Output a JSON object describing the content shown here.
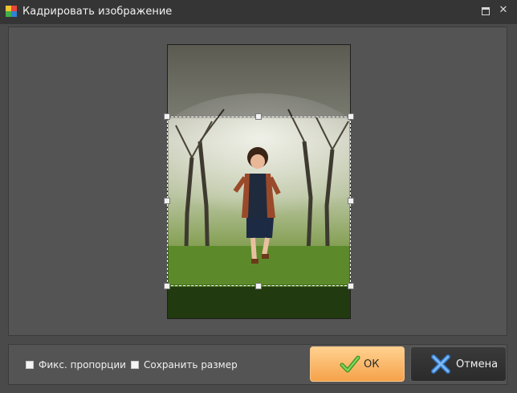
{
  "window": {
    "title": "Кадрировать изображение",
    "icons": {
      "app": "app-logo-icon",
      "maximize": "maximize-icon",
      "close": "close-icon"
    },
    "close_glyph": "✕"
  },
  "options": {
    "fixed_ratio_label": "Фикс. пропорции",
    "keep_size_label": "Сохранить размер"
  },
  "buttons": {
    "ok_label": "ОК",
    "cancel_label": "Отмена",
    "ok_icon": "checkmark-icon",
    "cancel_icon": "cancel-x-icon"
  },
  "colors": {
    "window_bg": "#4a4a4a",
    "titlebar_bg": "#353535",
    "panel_bg": "#545454",
    "ok_button": "#f6a24a",
    "cancel_button": "#2b2b2b",
    "ok_check": "#5fbf3a",
    "cancel_x": "#5a9de8"
  }
}
